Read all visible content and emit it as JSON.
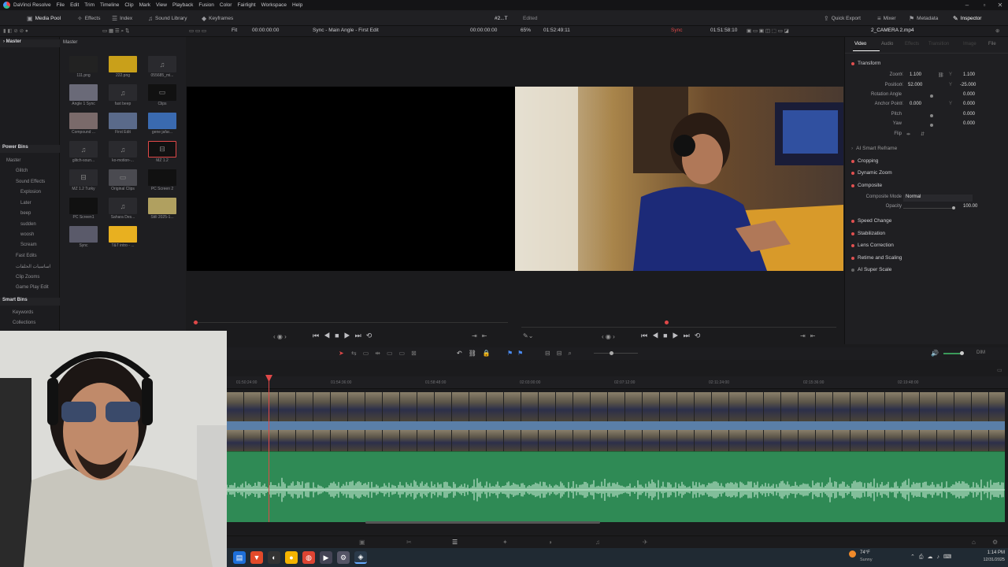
{
  "menubar": {
    "app": "DaVinci Resolve",
    "items": [
      "File",
      "Edit",
      "Trim",
      "Timeline",
      "Clip",
      "Mark",
      "View",
      "Playback",
      "Fusion",
      "Color",
      "Fairlight",
      "Workspace",
      "Help"
    ]
  },
  "toolbar": {
    "media_pool": "Media Pool",
    "effects": "Effects",
    "index": "Index",
    "sound_library": "Sound Library",
    "keyframes": "Keyframes",
    "project": "#2...T",
    "project_status": "Edited",
    "quick_export": "Quick Export",
    "mixer": "Mixer",
    "metadata": "Metadata",
    "inspector": "Inspector"
  },
  "viewer_bar": {
    "fit": "Fit",
    "source_tc": "00:00:00:00",
    "timeline_name": "Sync - Main Angle - First Edit",
    "tc_left": "00:00:00:00",
    "zoom": "65%",
    "duration": "01:52:49:11",
    "sync": "Sync",
    "tc_right": "01:51:58:10",
    "clip_name": "2_CAMERA 2.mp4"
  },
  "bins": {
    "master": "Master",
    "power_bins": "Power Bins",
    "power_items": [
      "Master",
      "Glitch",
      "Sound Effects",
      "Explosion",
      "Later",
      "beep",
      "sudden",
      "woosh",
      "Scream",
      "Fast Edits",
      "اساسيات الحلقات",
      "Clip Zooms",
      "Game Play Edit"
    ],
    "smart_bins": "Smart Bins",
    "smart_items": [
      "Keywords",
      "Collections"
    ]
  },
  "pool": {
    "header": "Master",
    "clips": [
      {
        "name": "111.png",
        "type": "image"
      },
      {
        "name": "222.png",
        "type": "image"
      },
      {
        "name": "055685_mi...",
        "type": "audio"
      },
      {
        "name": "Angle 1 Sync",
        "type": "video"
      },
      {
        "name": "fast beep",
        "type": "audio"
      },
      {
        "name": "Clips",
        "type": "bin"
      },
      {
        "name": "Compound ...",
        "type": "video"
      },
      {
        "name": "First Edit",
        "type": "video"
      },
      {
        "name": "gene jafar...",
        "type": "video"
      },
      {
        "name": "glitch-soun...",
        "type": "audio"
      },
      {
        "name": "ko-motion-...",
        "type": "audio"
      },
      {
        "name": "MZ 1.2",
        "type": "timeline"
      },
      {
        "name": "MZ 1.2 Turky",
        "type": "timeline"
      },
      {
        "name": "Original Clips",
        "type": "bin"
      },
      {
        "name": "PC Screen 2",
        "type": "video"
      },
      {
        "name": "PC Screen1",
        "type": "video"
      },
      {
        "name": "Sahara Des...",
        "type": "audio"
      },
      {
        "name": "Still 2025-1...",
        "type": "image"
      },
      {
        "name": "Sync",
        "type": "video"
      },
      {
        "name": "T&T intro - ...",
        "type": "image"
      }
    ]
  },
  "inspector": {
    "tabs": [
      "Video",
      "Audio",
      "Effects",
      "Transition",
      "Image",
      "File"
    ],
    "transform": "Transform",
    "zoom_label": "Zoom",
    "zoom_x": "1.100",
    "zoom_y": "1.100",
    "position_label": "Position",
    "position_x": "52.000",
    "position_y": "-25.000",
    "rotation_label": "Rotation Angle",
    "rotation": "0.000",
    "anchor_label": "Anchor Point",
    "anchor_x": "0.000",
    "anchor_y": "0.000",
    "pitch_label": "Pitch",
    "pitch": "0.000",
    "yaw_label": "Yaw",
    "yaw": "0.000",
    "flip_label": "Flip",
    "sections": [
      "AI Smart Reframe",
      "Cropping",
      "Dynamic Zoom",
      "Composite"
    ],
    "composite_mode_label": "Composite Mode",
    "composite_mode": "Normal",
    "opacity_label": "Opacity",
    "opacity": "100.00",
    "more_sections": [
      "Speed Change",
      "Stabilization",
      "Lens Correction",
      "Retime and Scaling",
      "AI Super Scale"
    ]
  },
  "timeline": {
    "timecodes": [
      "01:50:24:00",
      "01:54:36:00",
      "01:58:48:00",
      "02:03:00:00",
      "02:07:12:00",
      "02:11:24:00",
      "02:15:36:00",
      "02:19:48:00"
    ],
    "dim": "DIM"
  },
  "taskbar": {
    "weather_temp": "74°F",
    "weather_desc": "Sunny",
    "time": "1:14 PM",
    "date": "12/31/2025"
  },
  "colors": {
    "accent": "#e04848",
    "audio": "#2f8a55",
    "video_bar": "#5a7fa8"
  }
}
